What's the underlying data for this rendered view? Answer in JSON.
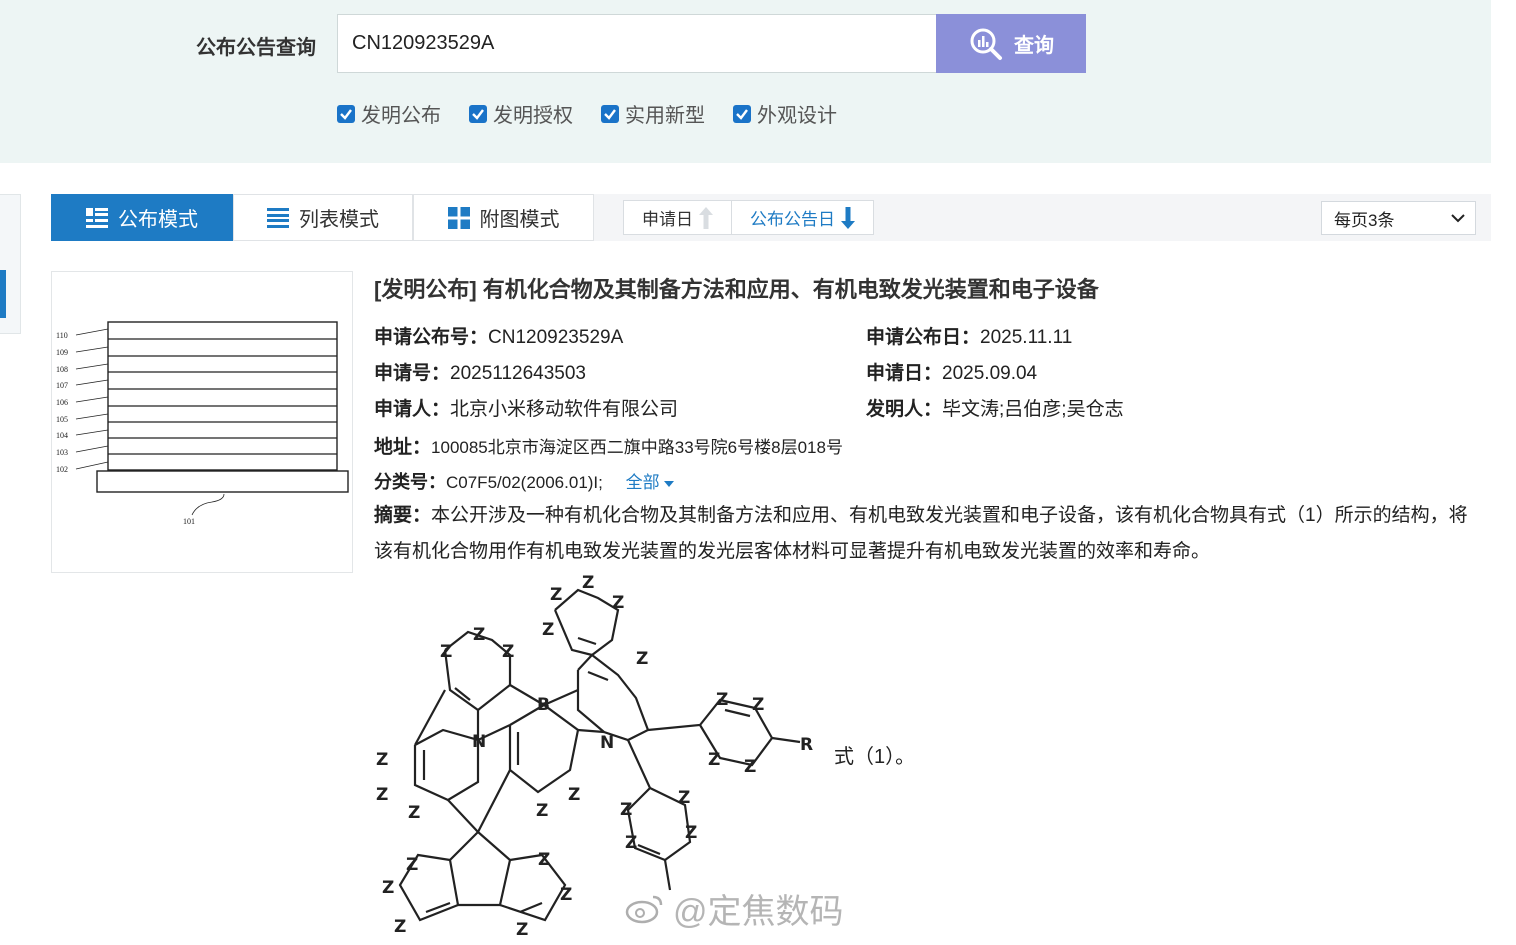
{
  "search": {
    "label": "公布公告查询",
    "value": "CN120923529A",
    "button_label": "查询"
  },
  "filters": [
    {
      "label": "发明公布",
      "checked": true
    },
    {
      "label": "发明授权",
      "checked": true
    },
    {
      "label": "实用新型",
      "checked": true
    },
    {
      "label": "外观设计",
      "checked": true
    }
  ],
  "view_modes": [
    {
      "label": "公布模式",
      "icon": "list-detail-icon",
      "active": true
    },
    {
      "label": "列表模式",
      "icon": "list-icon",
      "active": false
    },
    {
      "label": "附图模式",
      "icon": "grid-icon",
      "active": false
    }
  ],
  "sort": [
    {
      "label": "申请日",
      "direction": "up",
      "active": false
    },
    {
      "label": "公布公告日",
      "direction": "down",
      "active": true
    }
  ],
  "page_size": "每页3条",
  "colors": {
    "accent": "#1e7bc4",
    "search_button": "#8b90d9",
    "panel_bg": "#edf5f4"
  },
  "result": {
    "title": "[发明公布] 有机化合物及其制备方法和应用、有机电致发光装置和电子设备",
    "publication_no_label": "申请公布号",
    "publication_no": "CN120923529A",
    "publication_date_label": "申请公布日",
    "publication_date": "2025.11.11",
    "application_no_label": "申请号",
    "application_no": "2025112643503",
    "application_date_label": "申请日",
    "application_date": "2025.09.04",
    "applicant_label": "申请人",
    "applicant": "北京小米移动软件有限公司",
    "inventor_label": "发明人",
    "inventors": "毕文涛;吕伯彦;吴仓志",
    "address_label": "地址",
    "address": "100085北京市海淀区西二旗中路33号院6号楼8层018号",
    "classification_label": "分类号",
    "classification": "C07F5/02(2006.01)I;",
    "classification_more": "全部",
    "abstract_label": "摘要",
    "abstract": "本公开涉及一种有机化合物及其制备方法和应用、有机电致发光装置和电子设备，该有机化合物具有式（1）所示的结构，将该有机化合物用作有机电致发光装置的发光层客体材料可显著提升有机电致发光装置的效率和寿命。",
    "formula_label": "式（1）。",
    "figure_layer_labels": [
      "110",
      "109",
      "108",
      "107",
      "106",
      "105",
      "104",
      "103",
      "102"
    ],
    "figure_substrate_label": "101"
  },
  "watermark": "@定焦数码"
}
